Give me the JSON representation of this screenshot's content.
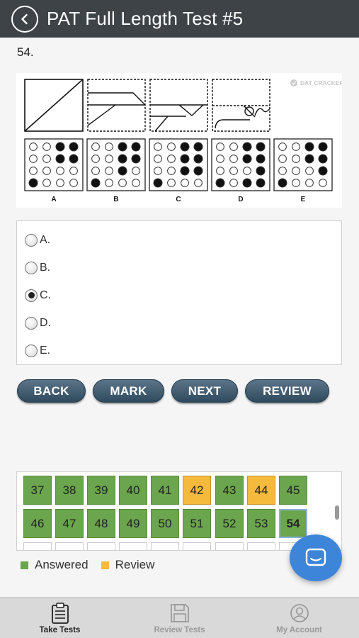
{
  "header": {
    "title": "PAT Full Length Test #5",
    "back_icon": "chevron-left-icon"
  },
  "question": {
    "number": "54."
  },
  "figure": {
    "watermark": "DAT CRACKER",
    "answer_labels": [
      "A",
      "B",
      "C",
      "D",
      "E"
    ]
  },
  "options": [
    {
      "label": "A.",
      "selected": false
    },
    {
      "label": "B.",
      "selected": false
    },
    {
      "label": "C.",
      "selected": true
    },
    {
      "label": "D.",
      "selected": false
    },
    {
      "label": "E.",
      "selected": false
    }
  ],
  "buttons": {
    "back": "BACK",
    "mark": "MARK",
    "next": "NEXT",
    "review": "REVIEW"
  },
  "grid": {
    "row1": [
      {
        "n": "37",
        "status": "answered"
      },
      {
        "n": "38",
        "status": "answered"
      },
      {
        "n": "39",
        "status": "answered"
      },
      {
        "n": "40",
        "status": "answered"
      },
      {
        "n": "41",
        "status": "answered"
      },
      {
        "n": "42",
        "status": "review"
      },
      {
        "n": "43",
        "status": "answered"
      },
      {
        "n": "44",
        "status": "review"
      },
      {
        "n": "45",
        "status": "answered"
      }
    ],
    "row2": [
      {
        "n": "46",
        "status": "answered"
      },
      {
        "n": "47",
        "status": "answered"
      },
      {
        "n": "48",
        "status": "answered"
      },
      {
        "n": "49",
        "status": "answered"
      },
      {
        "n": "50",
        "status": "answered"
      },
      {
        "n": "51",
        "status": "answered"
      },
      {
        "n": "52",
        "status": "answered"
      },
      {
        "n": "53",
        "status": "answered"
      },
      {
        "n": "54",
        "status": "current"
      }
    ]
  },
  "legend": {
    "answered": "Answered",
    "review": "Review"
  },
  "colors": {
    "header": "#3d4347",
    "answered": "#6ba54d",
    "review": "#f5b93c",
    "button": "#3f5a6f",
    "chat": "#3d85d8"
  },
  "tabs": [
    {
      "label": "Take Tests",
      "icon": "clipboard-icon",
      "active": true
    },
    {
      "label": "Review Tests",
      "icon": "floppy-disk-icon",
      "active": false
    },
    {
      "label": "My Account",
      "icon": "user-circle-icon",
      "active": false
    }
  ]
}
